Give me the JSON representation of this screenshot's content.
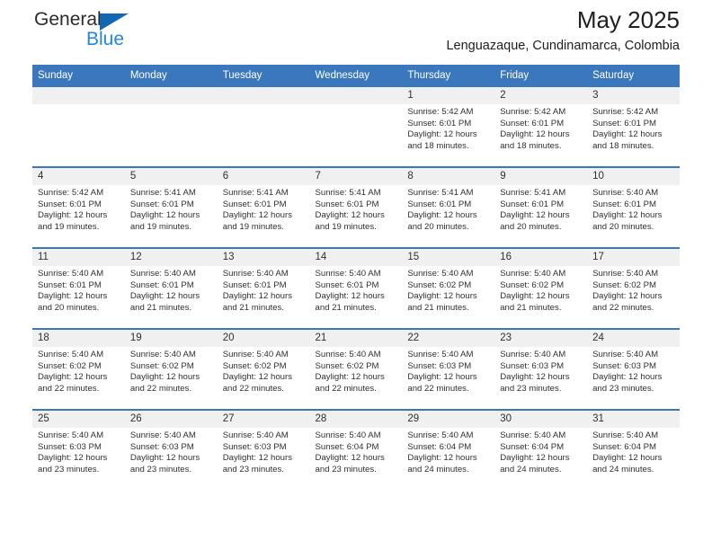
{
  "brand": {
    "name_top": "General",
    "name_bottom": "Blue",
    "triangle_color": "#1267b2",
    "blue_text_color": "#2288dd"
  },
  "header": {
    "title": "May 2025",
    "subtitle": "Lenguazaque, Cundinamarca, Colombia"
  },
  "theme": {
    "header_blue": "#3b77bc",
    "daynum_band": "#f0f0f0",
    "text": "#303030"
  },
  "weekdays": [
    "Sunday",
    "Monday",
    "Tuesday",
    "Wednesday",
    "Thursday",
    "Friday",
    "Saturday"
  ],
  "weeks": [
    [
      {
        "day": "",
        "empty": true
      },
      {
        "day": "",
        "empty": true
      },
      {
        "day": "",
        "empty": true
      },
      {
        "day": "",
        "empty": true
      },
      {
        "day": "1",
        "sunrise": "Sunrise: 5:42 AM",
        "sunset": "Sunset: 6:01 PM",
        "daylight": "Daylight: 12 hours and 18 minutes."
      },
      {
        "day": "2",
        "sunrise": "Sunrise: 5:42 AM",
        "sunset": "Sunset: 6:01 PM",
        "daylight": "Daylight: 12 hours and 18 minutes."
      },
      {
        "day": "3",
        "sunrise": "Sunrise: 5:42 AM",
        "sunset": "Sunset: 6:01 PM",
        "daylight": "Daylight: 12 hours and 18 minutes."
      }
    ],
    [
      {
        "day": "4",
        "sunrise": "Sunrise: 5:42 AM",
        "sunset": "Sunset: 6:01 PM",
        "daylight": "Daylight: 12 hours and 19 minutes."
      },
      {
        "day": "5",
        "sunrise": "Sunrise: 5:41 AM",
        "sunset": "Sunset: 6:01 PM",
        "daylight": "Daylight: 12 hours and 19 minutes."
      },
      {
        "day": "6",
        "sunrise": "Sunrise: 5:41 AM",
        "sunset": "Sunset: 6:01 PM",
        "daylight": "Daylight: 12 hours and 19 minutes."
      },
      {
        "day": "7",
        "sunrise": "Sunrise: 5:41 AM",
        "sunset": "Sunset: 6:01 PM",
        "daylight": "Daylight: 12 hours and 19 minutes."
      },
      {
        "day": "8",
        "sunrise": "Sunrise: 5:41 AM",
        "sunset": "Sunset: 6:01 PM",
        "daylight": "Daylight: 12 hours and 20 minutes."
      },
      {
        "day": "9",
        "sunrise": "Sunrise: 5:41 AM",
        "sunset": "Sunset: 6:01 PM",
        "daylight": "Daylight: 12 hours and 20 minutes."
      },
      {
        "day": "10",
        "sunrise": "Sunrise: 5:40 AM",
        "sunset": "Sunset: 6:01 PM",
        "daylight": "Daylight: 12 hours and 20 minutes."
      }
    ],
    [
      {
        "day": "11",
        "sunrise": "Sunrise: 5:40 AM",
        "sunset": "Sunset: 6:01 PM",
        "daylight": "Daylight: 12 hours and 20 minutes."
      },
      {
        "day": "12",
        "sunrise": "Sunrise: 5:40 AM",
        "sunset": "Sunset: 6:01 PM",
        "daylight": "Daylight: 12 hours and 21 minutes."
      },
      {
        "day": "13",
        "sunrise": "Sunrise: 5:40 AM",
        "sunset": "Sunset: 6:01 PM",
        "daylight": "Daylight: 12 hours and 21 minutes."
      },
      {
        "day": "14",
        "sunrise": "Sunrise: 5:40 AM",
        "sunset": "Sunset: 6:01 PM",
        "daylight": "Daylight: 12 hours and 21 minutes."
      },
      {
        "day": "15",
        "sunrise": "Sunrise: 5:40 AM",
        "sunset": "Sunset: 6:02 PM",
        "daylight": "Daylight: 12 hours and 21 minutes."
      },
      {
        "day": "16",
        "sunrise": "Sunrise: 5:40 AM",
        "sunset": "Sunset: 6:02 PM",
        "daylight": "Daylight: 12 hours and 21 minutes."
      },
      {
        "day": "17",
        "sunrise": "Sunrise: 5:40 AM",
        "sunset": "Sunset: 6:02 PM",
        "daylight": "Daylight: 12 hours and 22 minutes."
      }
    ],
    [
      {
        "day": "18",
        "sunrise": "Sunrise: 5:40 AM",
        "sunset": "Sunset: 6:02 PM",
        "daylight": "Daylight: 12 hours and 22 minutes."
      },
      {
        "day": "19",
        "sunrise": "Sunrise: 5:40 AM",
        "sunset": "Sunset: 6:02 PM",
        "daylight": "Daylight: 12 hours and 22 minutes."
      },
      {
        "day": "20",
        "sunrise": "Sunrise: 5:40 AM",
        "sunset": "Sunset: 6:02 PM",
        "daylight": "Daylight: 12 hours and 22 minutes."
      },
      {
        "day": "21",
        "sunrise": "Sunrise: 5:40 AM",
        "sunset": "Sunset: 6:02 PM",
        "daylight": "Daylight: 12 hours and 22 minutes."
      },
      {
        "day": "22",
        "sunrise": "Sunrise: 5:40 AM",
        "sunset": "Sunset: 6:03 PM",
        "daylight": "Daylight: 12 hours and 22 minutes."
      },
      {
        "day": "23",
        "sunrise": "Sunrise: 5:40 AM",
        "sunset": "Sunset: 6:03 PM",
        "daylight": "Daylight: 12 hours and 23 minutes."
      },
      {
        "day": "24",
        "sunrise": "Sunrise: 5:40 AM",
        "sunset": "Sunset: 6:03 PM",
        "daylight": "Daylight: 12 hours and 23 minutes."
      }
    ],
    [
      {
        "day": "25",
        "sunrise": "Sunrise: 5:40 AM",
        "sunset": "Sunset: 6:03 PM",
        "daylight": "Daylight: 12 hours and 23 minutes."
      },
      {
        "day": "26",
        "sunrise": "Sunrise: 5:40 AM",
        "sunset": "Sunset: 6:03 PM",
        "daylight": "Daylight: 12 hours and 23 minutes."
      },
      {
        "day": "27",
        "sunrise": "Sunrise: 5:40 AM",
        "sunset": "Sunset: 6:03 PM",
        "daylight": "Daylight: 12 hours and 23 minutes."
      },
      {
        "day": "28",
        "sunrise": "Sunrise: 5:40 AM",
        "sunset": "Sunset: 6:04 PM",
        "daylight": "Daylight: 12 hours and 23 minutes."
      },
      {
        "day": "29",
        "sunrise": "Sunrise: 5:40 AM",
        "sunset": "Sunset: 6:04 PM",
        "daylight": "Daylight: 12 hours and 24 minutes."
      },
      {
        "day": "30",
        "sunrise": "Sunrise: 5:40 AM",
        "sunset": "Sunset: 6:04 PM",
        "daylight": "Daylight: 12 hours and 24 minutes."
      },
      {
        "day": "31",
        "sunrise": "Sunrise: 5:40 AM",
        "sunset": "Sunset: 6:04 PM",
        "daylight": "Daylight: 12 hours and 24 minutes."
      }
    ]
  ]
}
